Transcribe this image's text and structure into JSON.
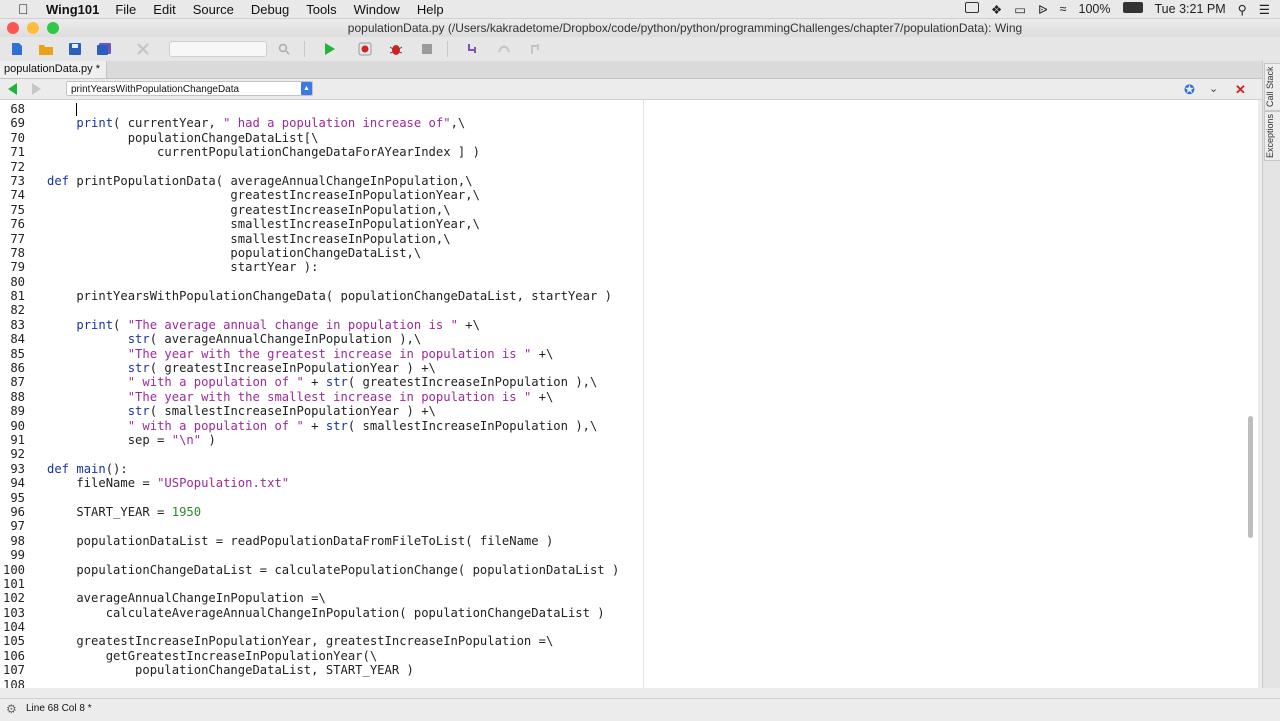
{
  "menubar": {
    "app_name": "Wing101",
    "items": [
      "File",
      "Edit",
      "Source",
      "Debug",
      "Tools",
      "Window",
      "Help"
    ],
    "battery": "100%",
    "clock": "Tue 3:21 PM"
  },
  "window": {
    "title": "populationData.py (/Users/kakradetome/Dropbox/code/python/python/programmingChallenges/chapter7/populationData): Wing"
  },
  "tab": {
    "label": "populationData.py *"
  },
  "nav": {
    "scope": "printYearsWithPopulationChangeData"
  },
  "side_tabs": [
    "Call Stack",
    "Exceptions"
  ],
  "status": {
    "text": "Line 68 Col 8 *"
  },
  "editor": {
    "lines": [
      {
        "n": "68",
        "t": ""
      },
      {
        "n": "69",
        "t": "    print( currentYear, \" had a population increase of\",\\"
      },
      {
        "n": "70",
        "t": "           populationChangeDataList[\\"
      },
      {
        "n": "71",
        "t": "               currentPopulationChangeDataForAYearIndex ] )"
      },
      {
        "n": "72",
        "t": ""
      },
      {
        "n": "73",
        "t": "def printPopulationData( averageAnnualChangeInPopulation,\\"
      },
      {
        "n": "74",
        "t": "                         greatestIncreaseInPopulationYear,\\"
      },
      {
        "n": "75",
        "t": "                         greatestIncreaseInPopulation,\\"
      },
      {
        "n": "76",
        "t": "                         smallestIncreaseInPopulationYear,\\"
      },
      {
        "n": "77",
        "t": "                         smallestIncreaseInPopulation,\\"
      },
      {
        "n": "78",
        "t": "                         populationChangeDataList,\\"
      },
      {
        "n": "79",
        "t": "                         startYear ):"
      },
      {
        "n": "80",
        "t": ""
      },
      {
        "n": "81",
        "t": "    printYearsWithPopulationChangeData( populationChangeDataList, startYear )"
      },
      {
        "n": "82",
        "t": ""
      },
      {
        "n": "83",
        "t": "    print( \"The average annual change in population is \" +\\"
      },
      {
        "n": "84",
        "t": "           str( averageAnnualChangeInPopulation ),\\"
      },
      {
        "n": "85",
        "t": "           \"The year with the greatest increase in population is \" +\\"
      },
      {
        "n": "86",
        "t": "           str( greatestIncreaseInPopulationYear ) +\\"
      },
      {
        "n": "87",
        "t": "           \" with a population of \" + str( greatestIncreaseInPopulation ),\\"
      },
      {
        "n": "88",
        "t": "           \"The year with the smallest increase in population is \" +\\"
      },
      {
        "n": "89",
        "t": "           str( smallestIncreaseInPopulationYear ) +\\"
      },
      {
        "n": "90",
        "t": "           \" with a population of \" + str( smallestIncreaseInPopulation ),\\"
      },
      {
        "n": "91",
        "t": "           sep = \"\\n\" )"
      },
      {
        "n": "92",
        "t": ""
      },
      {
        "n": "93",
        "t": "def main():"
      },
      {
        "n": "94",
        "t": "    fileName = \"USPopulation.txt\""
      },
      {
        "n": "95",
        "t": ""
      },
      {
        "n": "96",
        "t": "    START_YEAR = 1950"
      },
      {
        "n": "97",
        "t": ""
      },
      {
        "n": "98",
        "t": "    populationDataList = readPopulationDataFromFileToList( fileName )"
      },
      {
        "n": "99",
        "t": ""
      },
      {
        "n": "100",
        "t": "    populationChangeDataList = calculatePopulationChange( populationDataList )"
      },
      {
        "n": "101",
        "t": ""
      },
      {
        "n": "102",
        "t": "    averageAnnualChangeInPopulation =\\"
      },
      {
        "n": "103",
        "t": "        calculateAverageAnnualChangeInPopulation( populationChangeDataList )"
      },
      {
        "n": "104",
        "t": ""
      },
      {
        "n": "105",
        "t": "    greatestIncreaseInPopulationYear, greatestIncreaseInPopulation =\\"
      },
      {
        "n": "106",
        "t": "        getGreatestIncreaseInPopulationYear(\\"
      },
      {
        "n": "107",
        "t": "            populationChangeDataList, START_YEAR )"
      },
      {
        "n": "108",
        "t": ""
      }
    ]
  },
  "colors": {
    "keyword": "#1a32a8",
    "string": "#9c2a9c",
    "number": "#2b8a2b",
    "run_green": "#1fb53a",
    "close_red": "#d0231f"
  }
}
